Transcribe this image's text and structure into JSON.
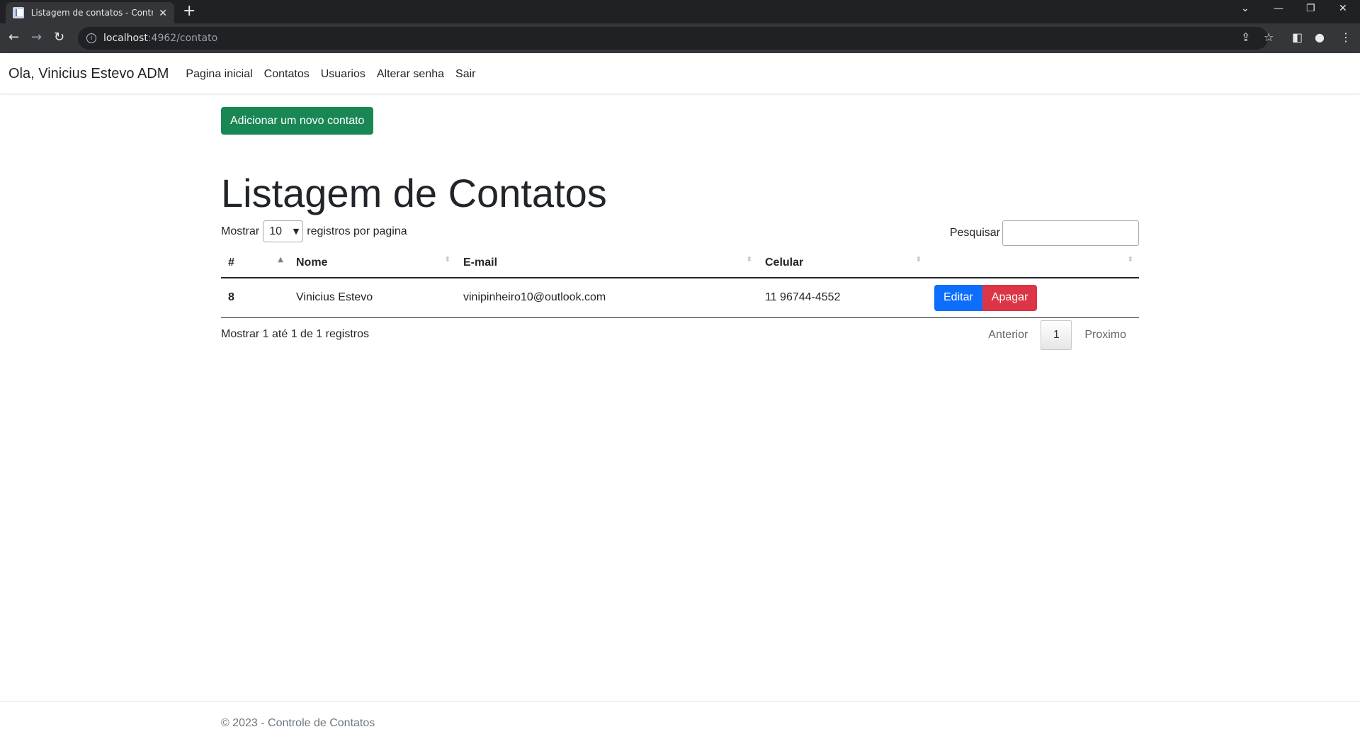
{
  "browser": {
    "tab_title": "Listagem de contatos - Controle",
    "tab_close": "✕",
    "new_tab": "+",
    "url_host": "localhost",
    "url_path": ":4962/contato"
  },
  "navbar": {
    "brand": "Ola, Vinicius Estevo ADM",
    "links": [
      "Pagina inicial",
      "Contatos",
      "Usuarios",
      "Alterar senha",
      "Sair"
    ]
  },
  "page": {
    "add_button": "Adicionar um novo contato",
    "title": "Listagem de Contatos",
    "length": {
      "prefix": "Mostrar",
      "value": "10",
      "suffix": "registros por pagina"
    },
    "search_label": "Pesquisar",
    "search_value": ""
  },
  "table": {
    "headers": [
      "#",
      "Nome",
      "E-mail",
      "Celular",
      ""
    ],
    "rows": [
      {
        "id": "8",
        "nome": "Vinicius Estevo",
        "email": "vinipinheiro10@outlook.com",
        "celular": "11 96744-4552",
        "edit": "Editar",
        "delete": "Apagar"
      }
    ]
  },
  "pagination": {
    "info": "Mostrar 1 até 1 de 1 registros",
    "prev": "Anterior",
    "current": "1",
    "next": "Proximo"
  },
  "footer": {
    "text": "© 2023 - Controle de Contatos"
  },
  "colors": {
    "success": "#198754",
    "primary": "#0d6efd",
    "danger": "#dc3545"
  }
}
